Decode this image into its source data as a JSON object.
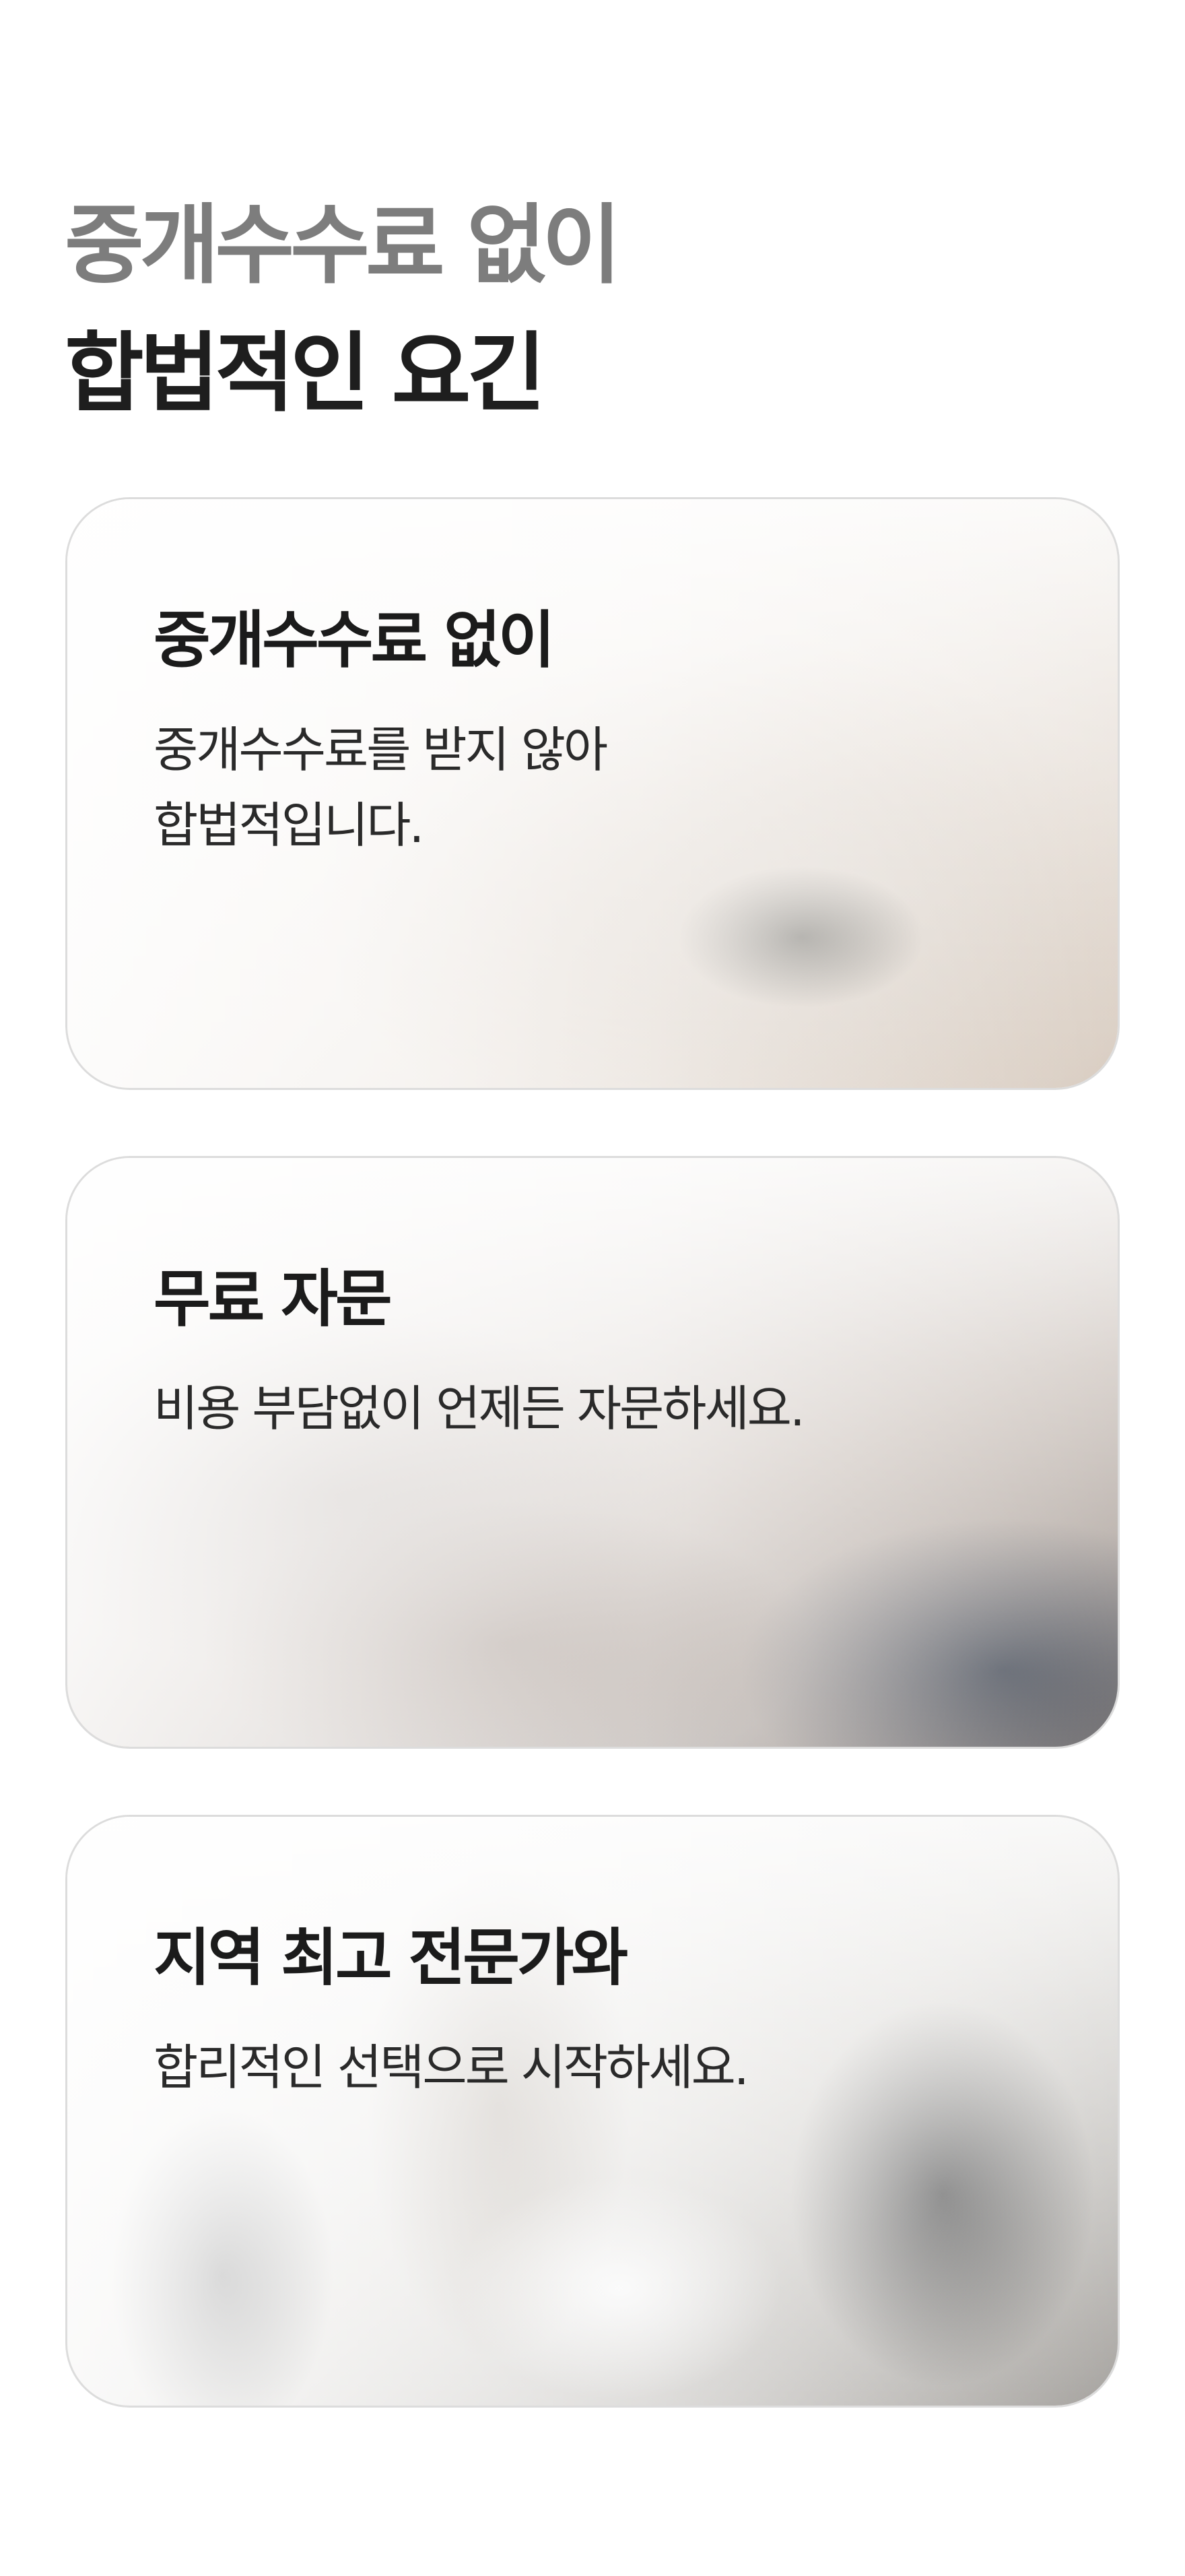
{
  "headline": {
    "line1": "중개수수료 없이",
    "line2": "합법적인 요긴"
  },
  "cards": [
    {
      "title": "중개수수료 없이",
      "desc_lines": [
        "중개수수료를 받지 않아",
        "합법적입니다."
      ]
    },
    {
      "title": "무료 자문",
      "desc_lines": [
        "비용 부담없이 언제든 자문하세요."
      ]
    },
    {
      "title": "지역 최고 전문가와",
      "desc_lines": [
        "합리적인 선택으로 시작하세요."
      ]
    }
  ],
  "colors": {
    "headline_muted": "#7d7d7d",
    "headline_strong": "#1e1e1e",
    "card_border": "#dcdcdc"
  }
}
